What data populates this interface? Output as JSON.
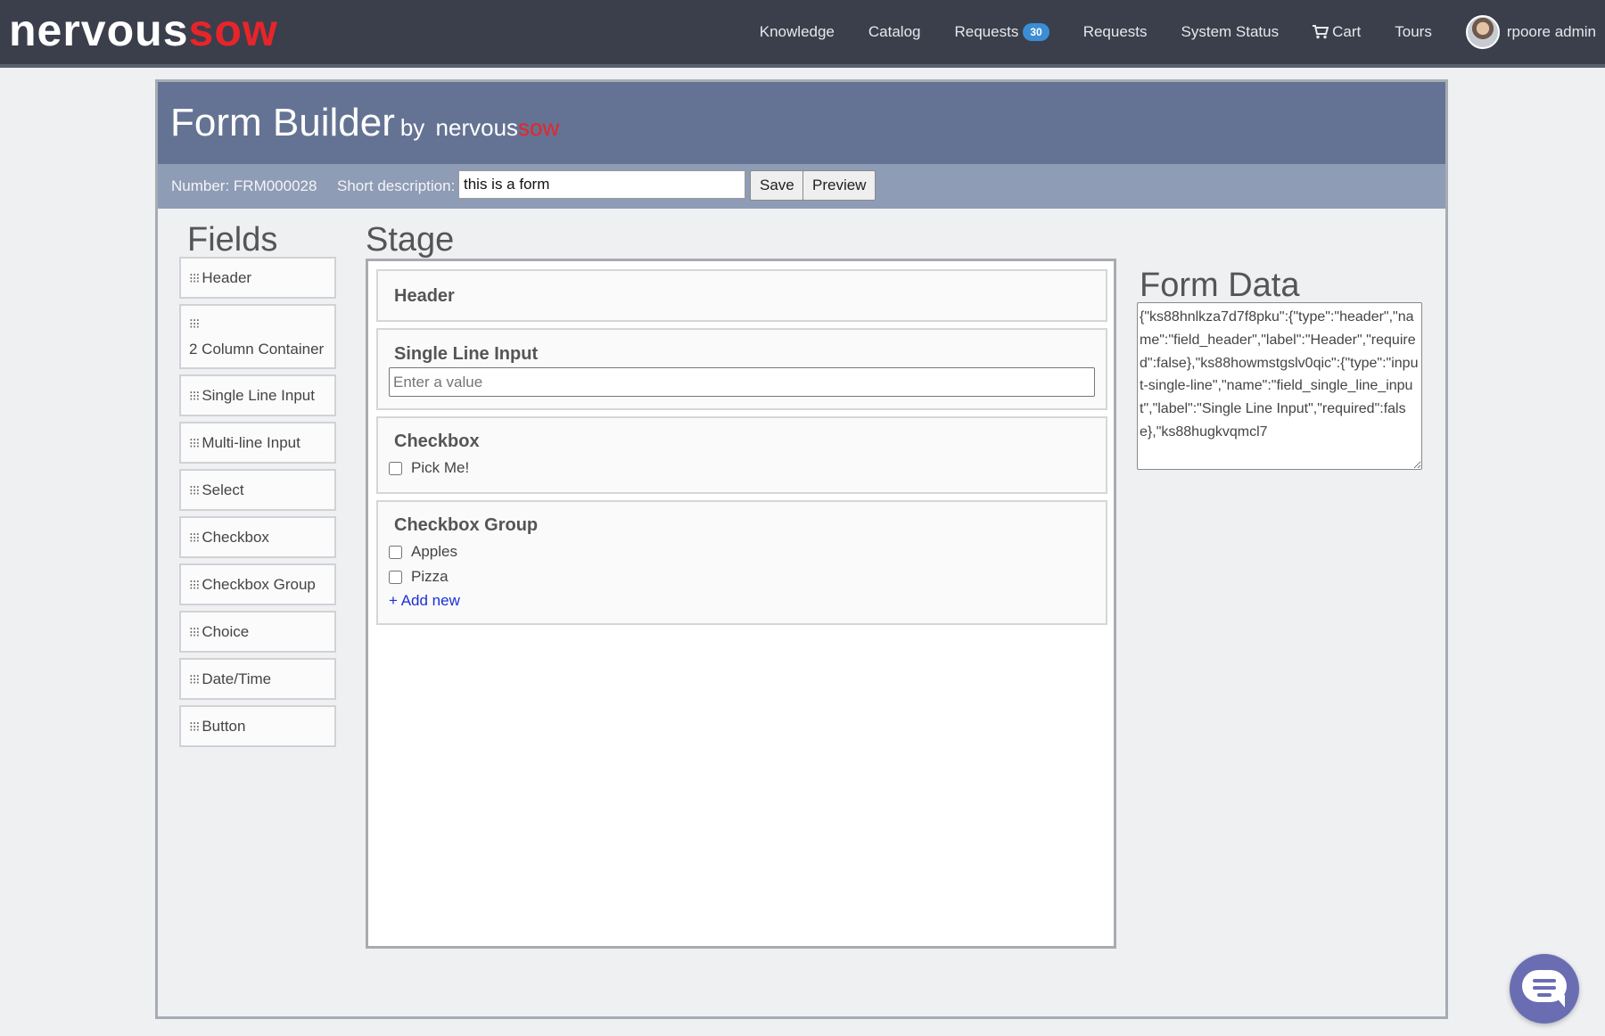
{
  "brand": {
    "part1": "nervous",
    "part2": "sow"
  },
  "nav": {
    "knowledge": "Knowledge",
    "catalog": "Catalog",
    "requests_badge_label": "Requests",
    "requests_count": "30",
    "requests": "Requests",
    "system_status": "System Status",
    "cart": "Cart",
    "tours": "Tours",
    "user": "rpoore admin"
  },
  "header": {
    "title": "Form Builder",
    "by": "by",
    "brand_part1": "nervous",
    "brand_part2": "sow"
  },
  "toolbar": {
    "number": "Number: FRM000028",
    "short_description_label": "Short description:",
    "short_description_value": "this is a form",
    "save_label": "Save",
    "preview_label": "Preview"
  },
  "fields": {
    "title": "Fields",
    "items": [
      "Header",
      "2 Column Container",
      "Single Line Input",
      "Multi-line Input",
      "Select",
      "Checkbox",
      "Checkbox Group",
      "Choice",
      "Date/Time",
      "Button"
    ]
  },
  "stage": {
    "title": "Stage",
    "header_block": {
      "label": "Header"
    },
    "single_line_block": {
      "label": "Single Line Input",
      "placeholder": "Enter a value"
    },
    "checkbox_block": {
      "label": "Checkbox",
      "option": "Pick Me!"
    },
    "checkbox_group_block": {
      "label": "Checkbox Group",
      "options": [
        "Apples",
        "Pizza"
      ],
      "add_new": "+ Add new"
    }
  },
  "form_data": {
    "title": "Form Data",
    "json": "{\"ks88hnlkza7d7f8pku\":{\"type\":\"header\",\"name\":\"field_header\",\"label\":\"Header\",\"required\":false},\"ks88howmstgslv0qic\":{\"type\":\"input-single-line\",\"name\":\"field_single_line_input\",\"label\":\"Single Line Input\",\"required\":false},\"ks88hugkvqmcl7"
  },
  "colors": {
    "topbar": "#3a3f4b",
    "brand_accent": "#e8242b",
    "panel_header": "#647393",
    "panel_subbar": "#8e9cb6",
    "badge": "#3b8dd6",
    "chat": "#6b6db3"
  }
}
